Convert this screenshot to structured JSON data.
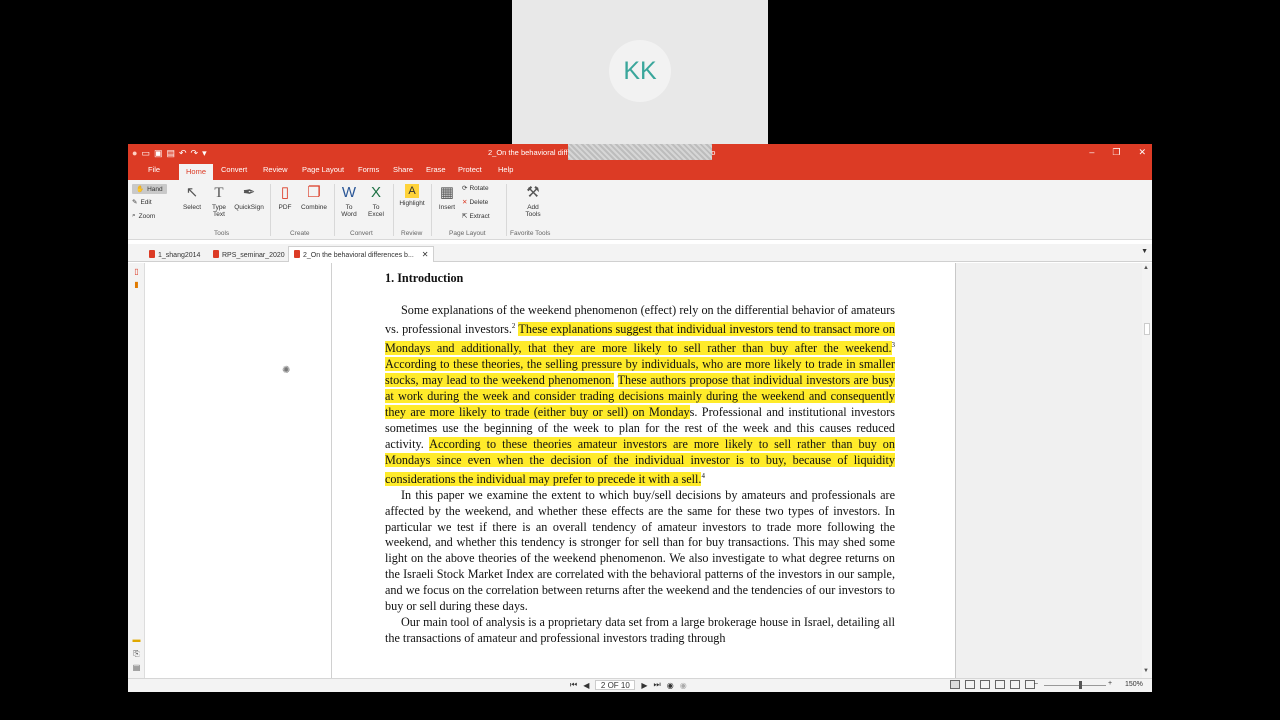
{
  "call": {
    "initials": "KK"
  },
  "window": {
    "title": "2_On the behavioral diff…investors after the weekend.pdf - Nitro Pro",
    "minimize": "–",
    "restore": "❐",
    "close": "✕"
  },
  "menu": [
    "File",
    "Home",
    "Convert",
    "Review",
    "Page Layout",
    "Forms",
    "Share",
    "Erase",
    "Protect",
    "Help"
  ],
  "ribbon": {
    "side_tools": {
      "hand": "Hand",
      "edit": "Edit",
      "zoom": "Zoom"
    },
    "select": "Select",
    "type_text": "Type Text",
    "quicksign": "QuickSign",
    "tools_group": "Tools",
    "pdf": "PDF",
    "combine": "Combine",
    "create_group": "Create",
    "to_word": "To Word",
    "to_excel": "To Excel",
    "convert_group": "Convert",
    "highlight": "Highlight",
    "review_group": "Review",
    "insert": "Insert",
    "rotate": "Rotate",
    "delete": "Delete",
    "extract": "Extract",
    "page_layout_group": "Page Layout",
    "add_tools": "Add Tools",
    "favorite_group": "Favorite Tools"
  },
  "tabs": [
    {
      "label": "1_shang2014"
    },
    {
      "label": "RPS_seminar_2020"
    },
    {
      "label": "2_On the behavioral differences b..."
    }
  ],
  "doc": {
    "heading": "1.  Introduction",
    "p1_a": "Some explanations of the weekend phenomenon (effect) rely on the differential behavior of amateurs vs. professional investors.",
    "sup2": "2",
    "p1_h1": "These explanations suggest that individual investors tend to transact more on Mondays and additionally, that they are more likely to sell rather than buy after the weekend.",
    "sup3": "3",
    "p1_h2": "According to these theories, the selling pressure by individuals, who are more likely to trade in smaller stocks, may lead to the weekend phenomenon.",
    "p1_h3": "These authors propose that individual investors are busy at work during the week and consider trading decisions mainly during the weekend and consequently they are more likely to trade (either buy or sell) on Monday",
    "p1_b": "s. Professional and institutional investors sometimes use the beginning of the week to plan for the rest of the week and this causes reduced activity.",
    "p1_h4": "According to these theories amateur investors are more likely to sell rather than buy on Mondays since even when the decision of the individual investor is to buy, because of liquidity considerations the individual may prefer to precede it with a sell.",
    "sup4": "4",
    "p2": "In this paper we examine the extent to which buy/sell decisions by amateurs and professionals are affected by the weekend, and whether these effects are the same for these two types of investors. In particular we test if there is an overall tendency of amateur investors to trade more following the weekend, and whether this tendency is stronger for sell than for buy transactions. This may shed some light on the above theories of the weekend phenomenon. We also investigate to what degree returns on the Israeli Stock Market Index are correlated with the behavioral patterns of the investors in our sample, and we focus on the correlation between returns after the weekend and the tendencies of our investors to buy or sell during these days.",
    "p3": "Our main tool of analysis is a proprietary data set from a large brokerage house in Israel, detailing all the transactions of amateur and professional investors trading through"
  },
  "status": {
    "page_indicator": "2 OF 10",
    "zoom": "150%"
  },
  "colors": {
    "accent": "#dc3b25",
    "highlight": "#ffeb2a",
    "avatar_text": "#3aa69b"
  }
}
